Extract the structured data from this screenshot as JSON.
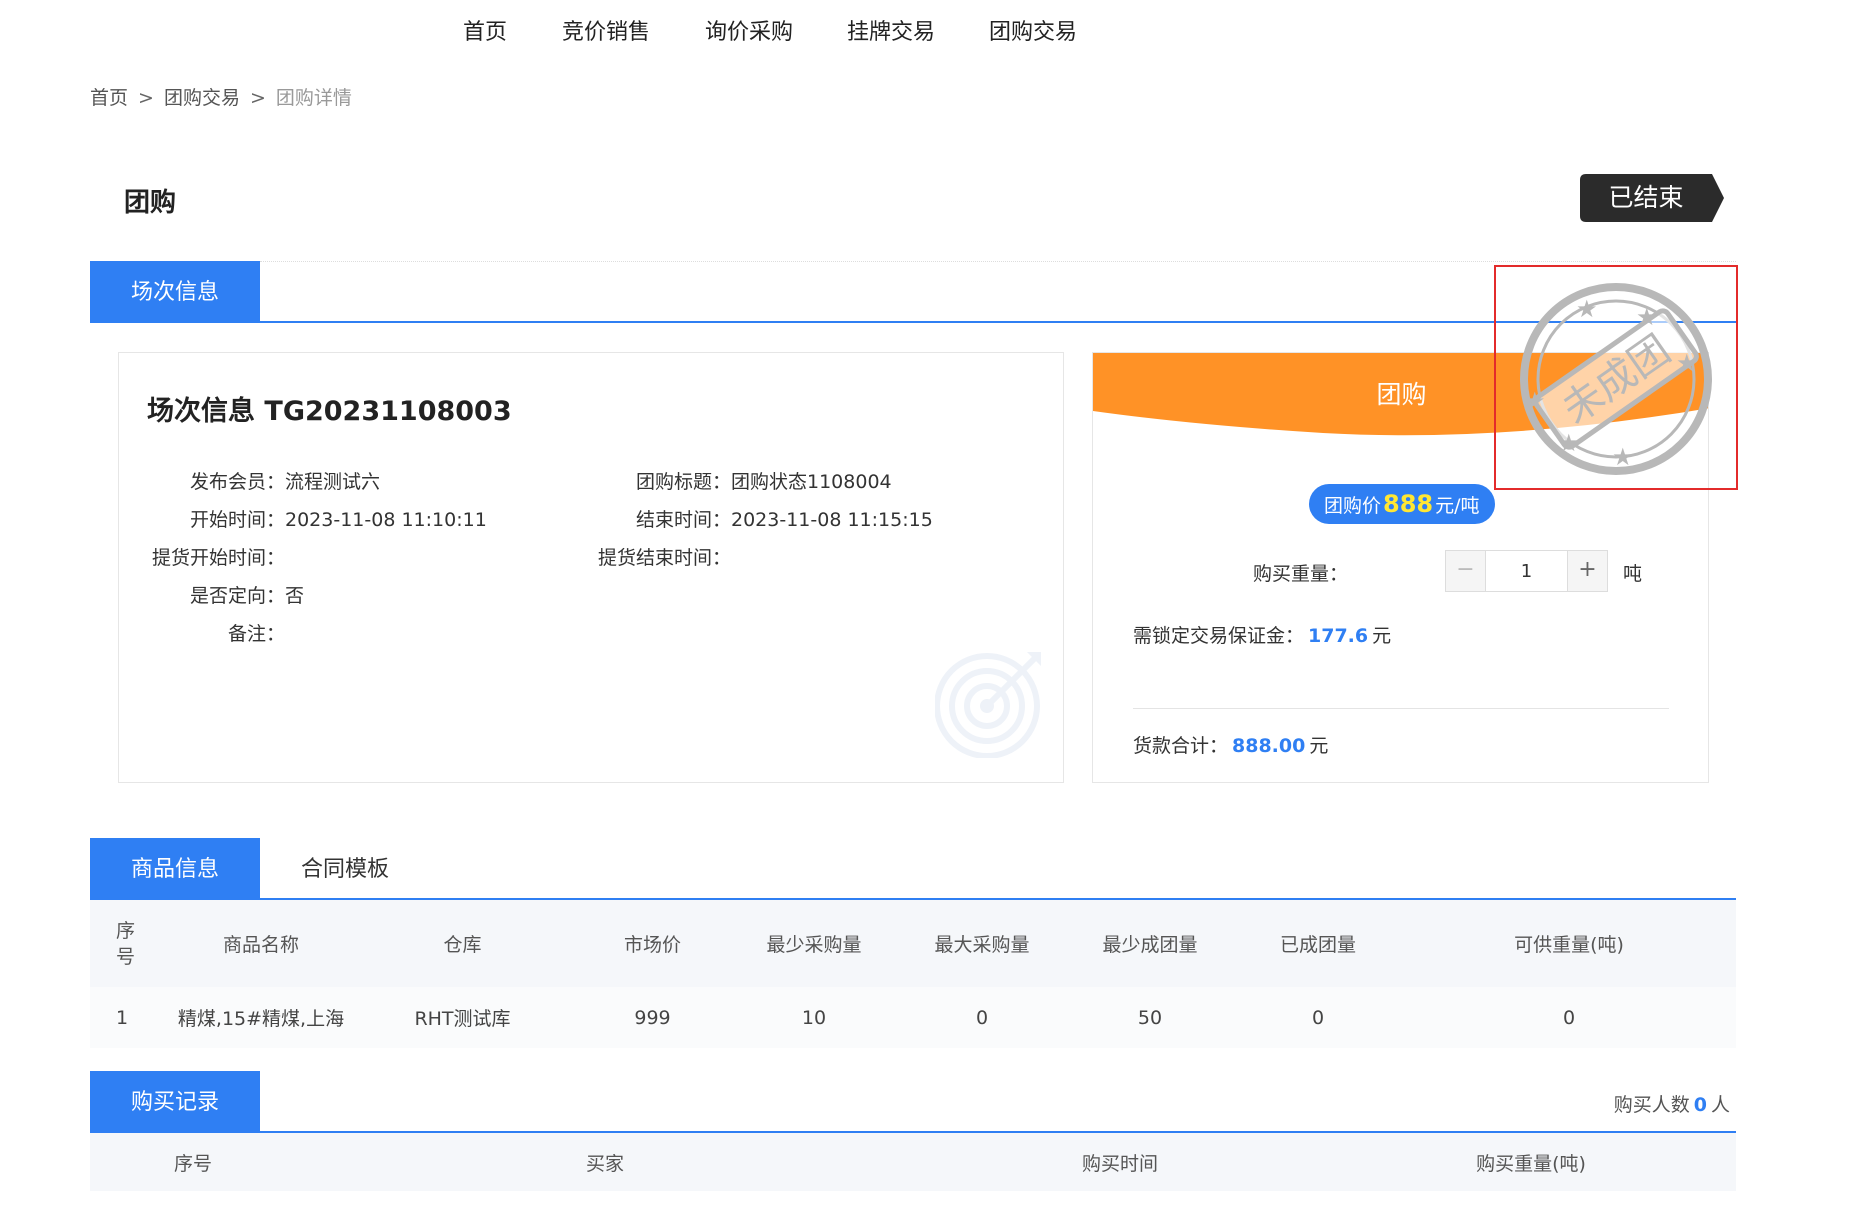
{
  "nav": {
    "items": [
      "首页",
      "竞价销售",
      "询价采购",
      "挂牌交易",
      "团购交易"
    ]
  },
  "breadcrumb": {
    "home": "首页",
    "sep": ">",
    "parent": "团购交易",
    "current": "团购详情"
  },
  "page": {
    "title": "团购",
    "status": "已结束"
  },
  "session_section": {
    "tab": "场次信息"
  },
  "session": {
    "title": "场次信息 TG20231108003",
    "publisher_label": "发布会员：",
    "publisher": "流程测试六",
    "group_title_label": "团购标题：",
    "group_title": "团购状态1108004",
    "start_label": "开始时间：",
    "start": "2023-11-08 11:10:11",
    "end_label": "结束时间：",
    "end": "2023-11-08 11:15:15",
    "pickup_start_label": "提货开始时间：",
    "pickup_start": "",
    "pickup_end_label": "提货结束时间：",
    "pickup_end": "",
    "directed_label": "是否定向：",
    "directed": "否",
    "remark_label": "备注：",
    "remark": ""
  },
  "purchase": {
    "banner": "团购",
    "price_label": "团购价",
    "price": "888",
    "price_unit": "元/吨",
    "qty_label": "购买重量：",
    "qty_minus": "−",
    "qty_value": "1",
    "qty_plus": "+",
    "qty_unit": "吨",
    "deposit_label": "需锁定交易保证金：",
    "deposit": "177.6",
    "deposit_unit": "元",
    "total_label": "货款合计：",
    "total": "888.00",
    "total_unit": "元"
  },
  "stamp": {
    "text": "未成团",
    "color": "#b8b8b8"
  },
  "goods_section": {
    "tabs": [
      "商品信息",
      "合同模板"
    ]
  },
  "goods_table": {
    "headers": [
      "序号",
      "商品名称",
      "仓库",
      "市场价",
      "最少采购量",
      "最大采购量",
      "最少成团量",
      "已成团量",
      "可供重量(吨)"
    ],
    "rows": [
      [
        "1",
        "精煤,15#精煤,上海",
        "RHT测试库",
        "999",
        "10",
        "0",
        "50",
        "0",
        "0"
      ]
    ]
  },
  "records_section": {
    "tab": "购买记录",
    "buyers_label": "购买人数",
    "buyers_count": "0",
    "buyers_unit": "人"
  },
  "records_table": {
    "headers": [
      "序号",
      "买家",
      "购买时间",
      "购买重量(吨)"
    ]
  },
  "colors": {
    "primary": "#2f7ff3",
    "orange": "#ff9226",
    "highlight": "#ffe733",
    "stamp_border": "#e32b2b",
    "status_bg": "#2b2b2b"
  }
}
